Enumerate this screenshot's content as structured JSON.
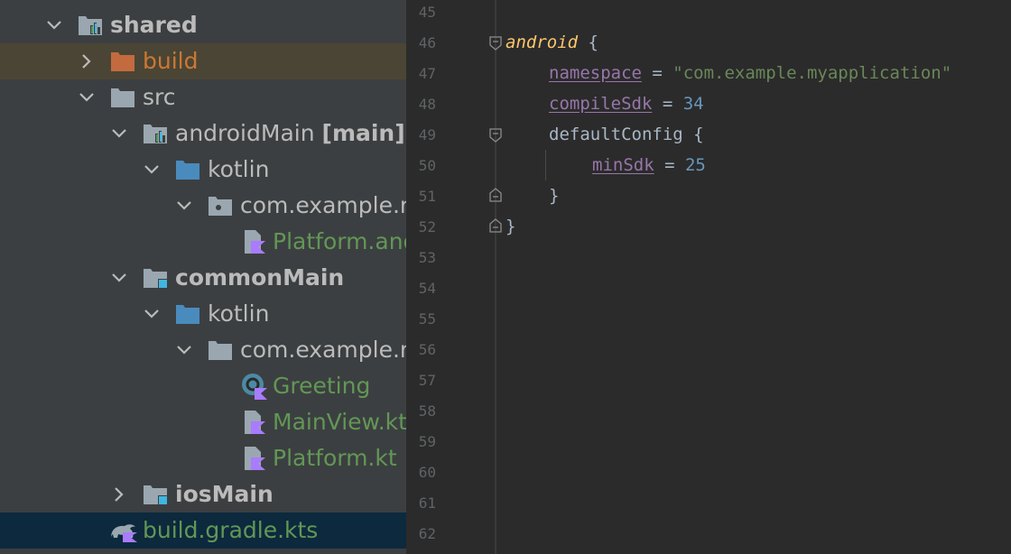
{
  "tree": {
    "rows": [
      {
        "label": "shared",
        "suffix": "",
        "color": "#bbbbbb",
        "bold": true,
        "icon": "module-folder-icon",
        "expanded": true
      },
      {
        "label": "build",
        "suffix": "",
        "color": "#cc7832",
        "bold": false,
        "icon": "excluded-folder-icon",
        "expanded": false
      },
      {
        "label": "src",
        "suffix": "",
        "color": "#bbbbbb",
        "bold": false,
        "icon": "folder-icon",
        "expanded": true
      },
      {
        "label": "androidMain",
        "suffix": "[main]",
        "color": "#bbbbbb",
        "bold": false,
        "icon": "module-folder-icon",
        "expanded": true
      },
      {
        "label": "kotlin",
        "suffix": "",
        "color": "#bbbbbb",
        "bold": false,
        "icon": "source-folder-icon",
        "expanded": true
      },
      {
        "label": "com.example.m",
        "suffix": "",
        "color": "#bbbbbb",
        "bold": false,
        "icon": "package-icon",
        "expanded": true
      },
      {
        "label": "Platform.and",
        "suffix": "",
        "color": "#629755",
        "bold": false,
        "icon": "kotlin-file-icon"
      },
      {
        "label": "commonMain",
        "suffix": "",
        "color": "#bbbbbb",
        "bold": true,
        "icon": "source-set-folder-icon",
        "expanded": true
      },
      {
        "label": "kotlin",
        "suffix": "",
        "color": "#bbbbbb",
        "bold": false,
        "icon": "source-folder-icon",
        "expanded": true
      },
      {
        "label": "com.example.m",
        "suffix": "",
        "color": "#bbbbbb",
        "bold": false,
        "icon": "package-icon",
        "expanded": true
      },
      {
        "label": "Greeting",
        "suffix": "",
        "color": "#629755",
        "bold": false,
        "icon": "kotlin-class-icon"
      },
      {
        "label": "MainView.kt",
        "suffix": "",
        "color": "#629755",
        "bold": false,
        "icon": "kotlin-file-icon"
      },
      {
        "label": "Platform.kt",
        "suffix": "",
        "color": "#629755",
        "bold": false,
        "icon": "kotlin-file-icon"
      },
      {
        "label": "iosMain",
        "suffix": "",
        "color": "#bbbbbb",
        "bold": true,
        "icon": "source-set-folder-icon",
        "expanded": false
      },
      {
        "label": "build.gradle.kts",
        "suffix": "",
        "color": "#629755",
        "bold": false,
        "icon": "gradle-file-icon"
      }
    ]
  },
  "editor": {
    "line_numbers": [
      "45",
      "46",
      "47",
      "48",
      "49",
      "50",
      "51",
      "52",
      "53",
      "54",
      "55",
      "56",
      "57",
      "58",
      "59",
      "60",
      "61",
      "62"
    ],
    "code": {
      "l46_kw": "android",
      "l46_rest": " {",
      "l47_prop": "namespace",
      "l47_eq": " = ",
      "l47_str": "\"com.example.myapplication\"",
      "l48_prop": "compileSdk",
      "l48_eq": " = ",
      "l48_num": "34",
      "l49_text": "defaultConfig {",
      "l50_prop": "minSdk",
      "l50_eq": " = ",
      "l50_num": "25",
      "l51_text": "}",
      "l52_text": "}"
    }
  },
  "colors": {
    "tree_bg": "#3c3f41",
    "editor_bg": "#2b2b2b",
    "selected_build_row": "#4b4535",
    "selected_gradle_row": "#0d293e",
    "kotlin_file_green": "#629755",
    "excluded_orange": "#cc7832",
    "keyword_yellow": "#ffc66d",
    "property_purple": "#9876aa",
    "string_green": "#6a8759",
    "number_blue": "#6897bb"
  }
}
